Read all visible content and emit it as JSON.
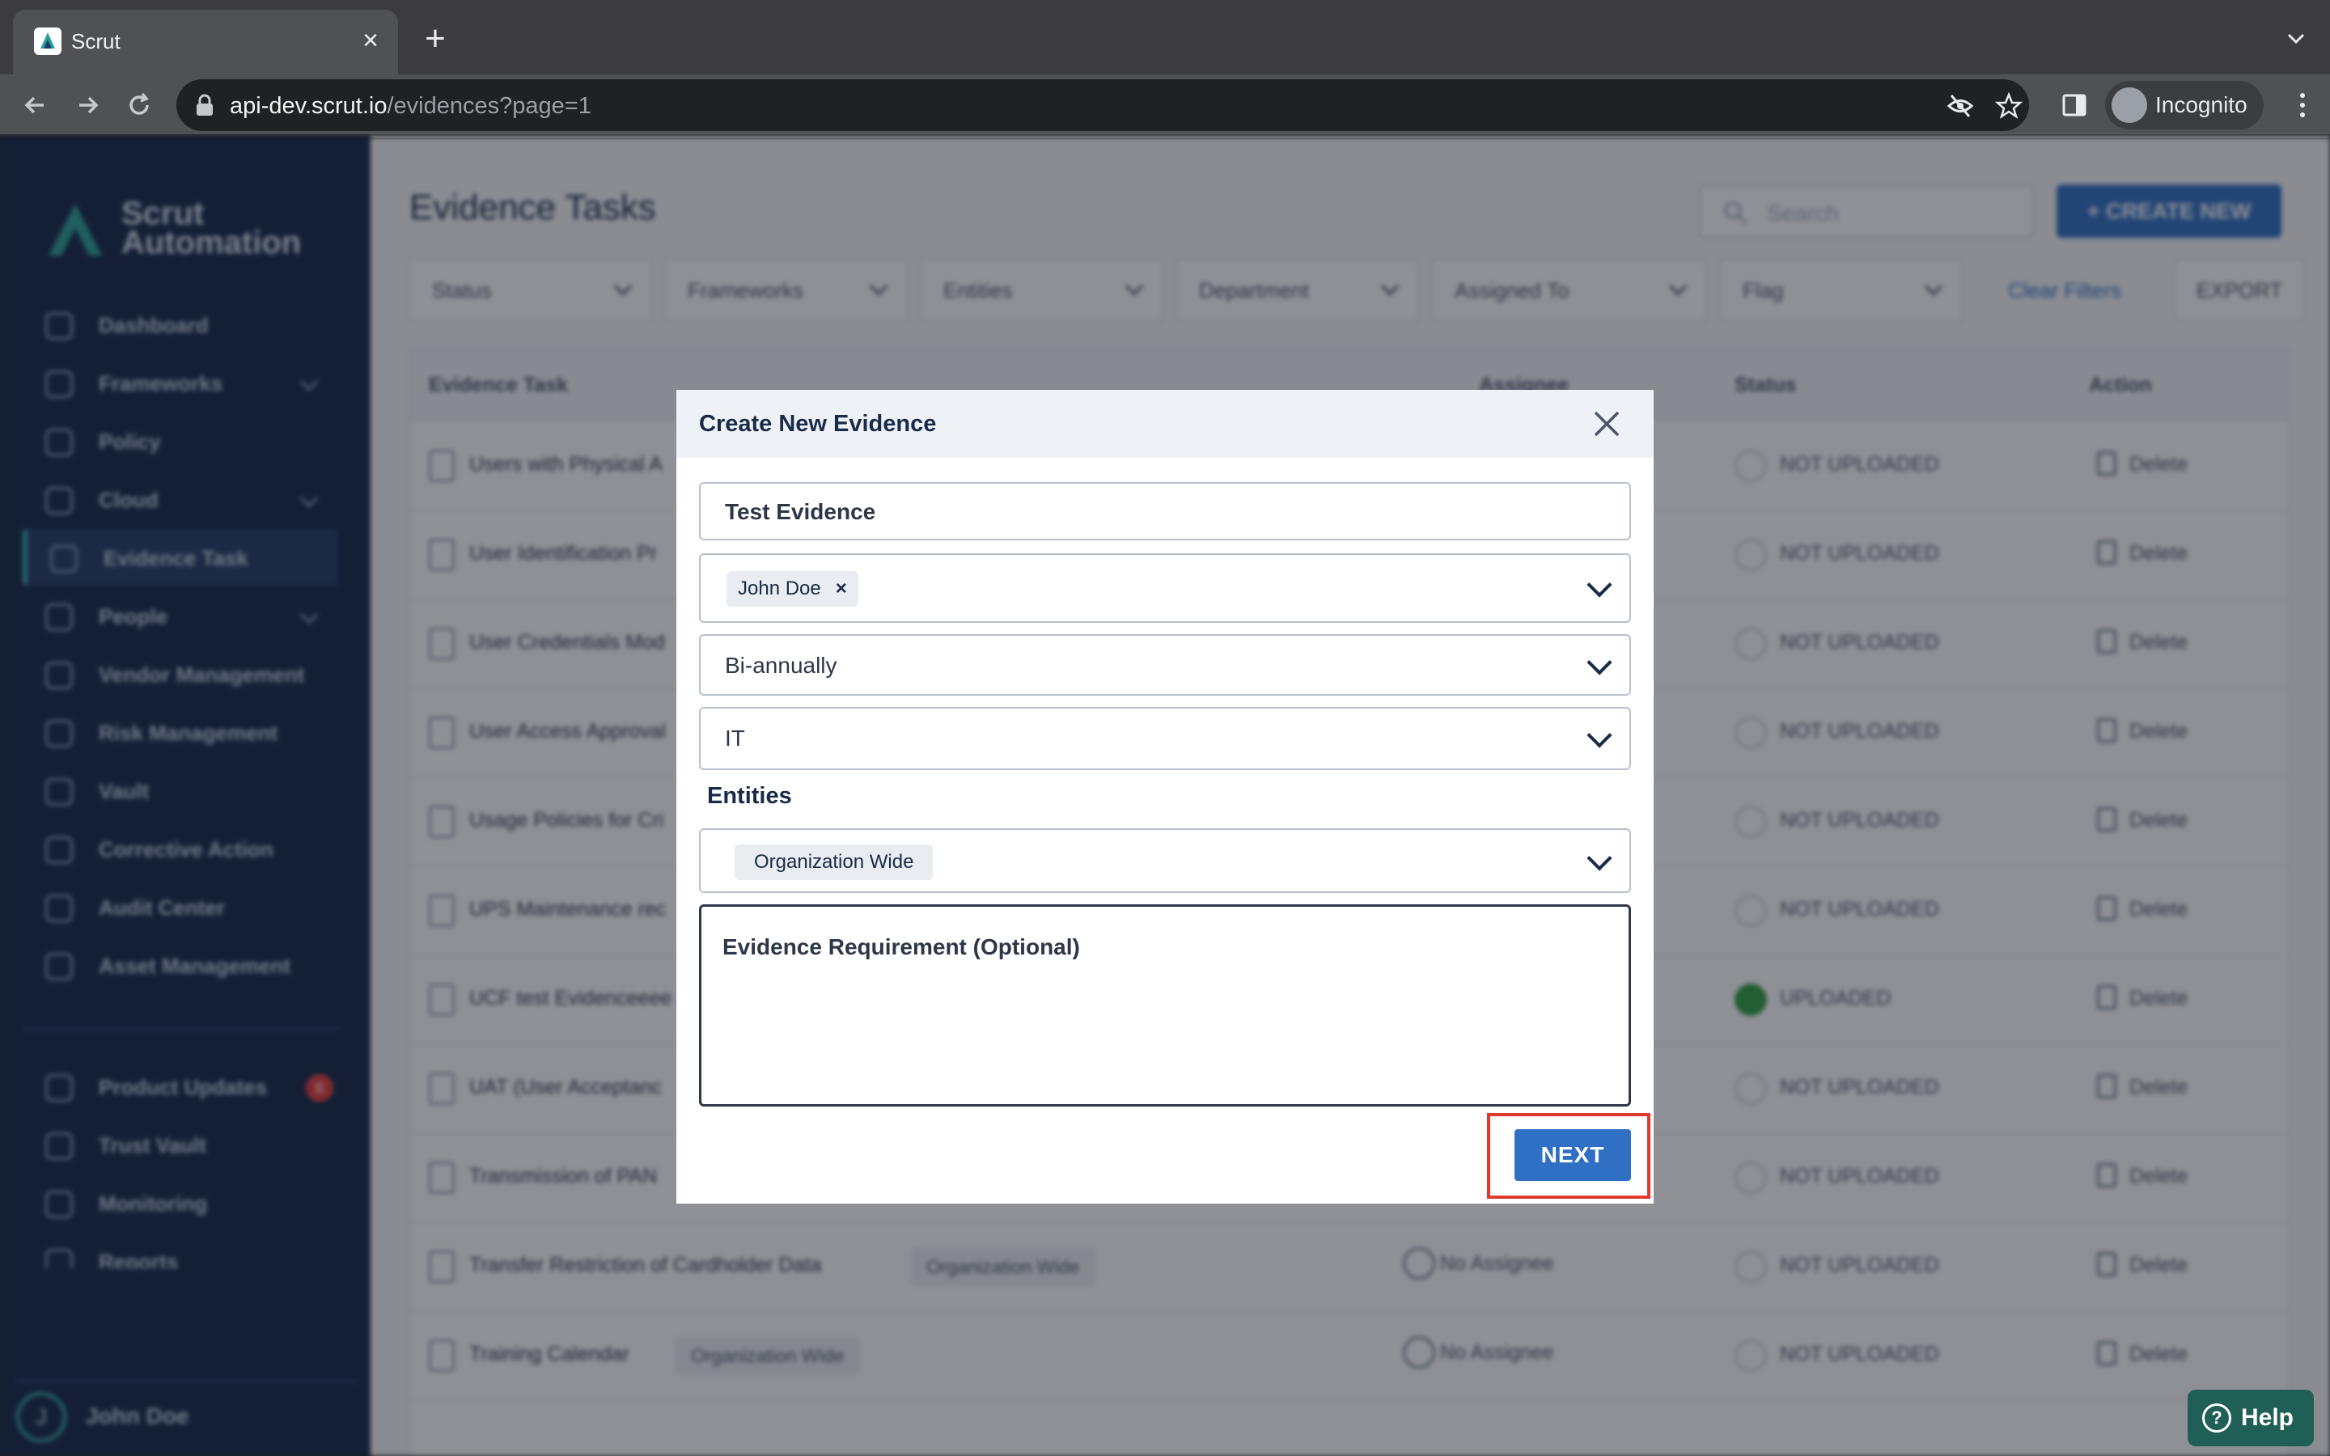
{
  "browser": {
    "tab_title": "Scrut",
    "url_host": "api-dev.scrut.io",
    "url_path": "/evidences?page=1",
    "incognito_label": "Incognito"
  },
  "sidebar": {
    "logo_line1": "Scrut",
    "logo_line2": "Automation",
    "items": [
      {
        "label": "Dashboard",
        "icon": "dashboard-icon"
      },
      {
        "label": "Frameworks",
        "icon": "frameworks-icon",
        "has_children": true
      },
      {
        "label": "Policy",
        "icon": "policy-icon"
      },
      {
        "label": "Cloud",
        "icon": "cloud-icon",
        "has_children": true
      },
      {
        "label": "Evidence Task",
        "icon": "evidence-icon",
        "active": true
      },
      {
        "label": "People",
        "icon": "people-icon",
        "has_children": true
      },
      {
        "label": "Vendor Management",
        "icon": "vendor-icon"
      },
      {
        "label": "Risk Management",
        "icon": "risk-icon"
      },
      {
        "label": "Vault",
        "icon": "vault-icon"
      },
      {
        "label": "Corrective Action",
        "icon": "check-icon"
      },
      {
        "label": "Audit Center",
        "icon": "audit-icon"
      },
      {
        "label": "Asset Management",
        "icon": "asset-icon"
      }
    ],
    "secondary_items": [
      {
        "label": "Product Updates",
        "icon": "megaphone-icon",
        "badge": "6"
      },
      {
        "label": "Trust Vault",
        "icon": "flag-icon"
      },
      {
        "label": "Monitoring",
        "icon": "chart-icon"
      },
      {
        "label": "Reports",
        "icon": "reports-icon"
      }
    ],
    "user_initial": "J",
    "user_name": "John Doe"
  },
  "main": {
    "title": "Evidence Tasks",
    "search_placeholder": "Search",
    "create_label": "+ CREATE NEW",
    "filters": [
      "Status",
      "Frameworks",
      "Entities",
      "Department",
      "Assigned To",
      "Flag"
    ],
    "clear_filters": "Clear Filters",
    "export_label": "EXPORT",
    "columns": [
      "Evidence Task",
      "Assignee",
      "Status",
      "Action"
    ],
    "rows": [
      {
        "name": "Users with Physical A",
        "status": "NOT UPLOADED",
        "action": "Delete"
      },
      {
        "name": "User Identification Pr",
        "status": "NOT UPLOADED",
        "action": "Delete"
      },
      {
        "name": "User Credentials Mod",
        "status": "NOT UPLOADED",
        "action": "Delete"
      },
      {
        "name": "User Access Approval",
        "status": "NOT UPLOADED",
        "action": "Delete"
      },
      {
        "name": "Usage Policies for Cri",
        "status": "NOT UPLOADED",
        "action": "Delete"
      },
      {
        "name": "UPS Maintenance rec",
        "status": "NOT UPLOADED",
        "action": "Delete"
      },
      {
        "name": "UCF test Evidenceeee",
        "status": "UPLOADED",
        "action": "Delete"
      },
      {
        "name": "UAT (User Acceptanc",
        "status": "NOT UPLOADED",
        "action": "Delete"
      },
      {
        "name": "Transmission of PAN",
        "status": "NOT UPLOADED",
        "action": "Delete"
      },
      {
        "name": "Transfer Restriction of Cardholder Data",
        "chip": "Organization Wide",
        "assignee": "No Assignee",
        "status": "NOT UPLOADED",
        "action": "Delete"
      },
      {
        "name": "Training Calendar",
        "chip": "Organization Wide",
        "assignee": "No Assignee",
        "status": "NOT UPLOADED",
        "action": "Delete"
      }
    ],
    "help_label": "Help"
  },
  "modal": {
    "title": "Create New Evidence",
    "name_value": "Test Evidence",
    "assignee_tag": "John Doe",
    "frequency_value": "Bi-annually",
    "department_value": "IT",
    "entities_label": "Entities",
    "entity_tag": "Organization Wide",
    "requirement_placeholder": "Evidence Requirement (Optional)",
    "next_label": "NEXT"
  },
  "colors": {
    "sidebar_bg": "#14284a",
    "primary": "#2f6fc4",
    "accent": "#38b2ac",
    "highlight_frame": "#e03a2f"
  }
}
